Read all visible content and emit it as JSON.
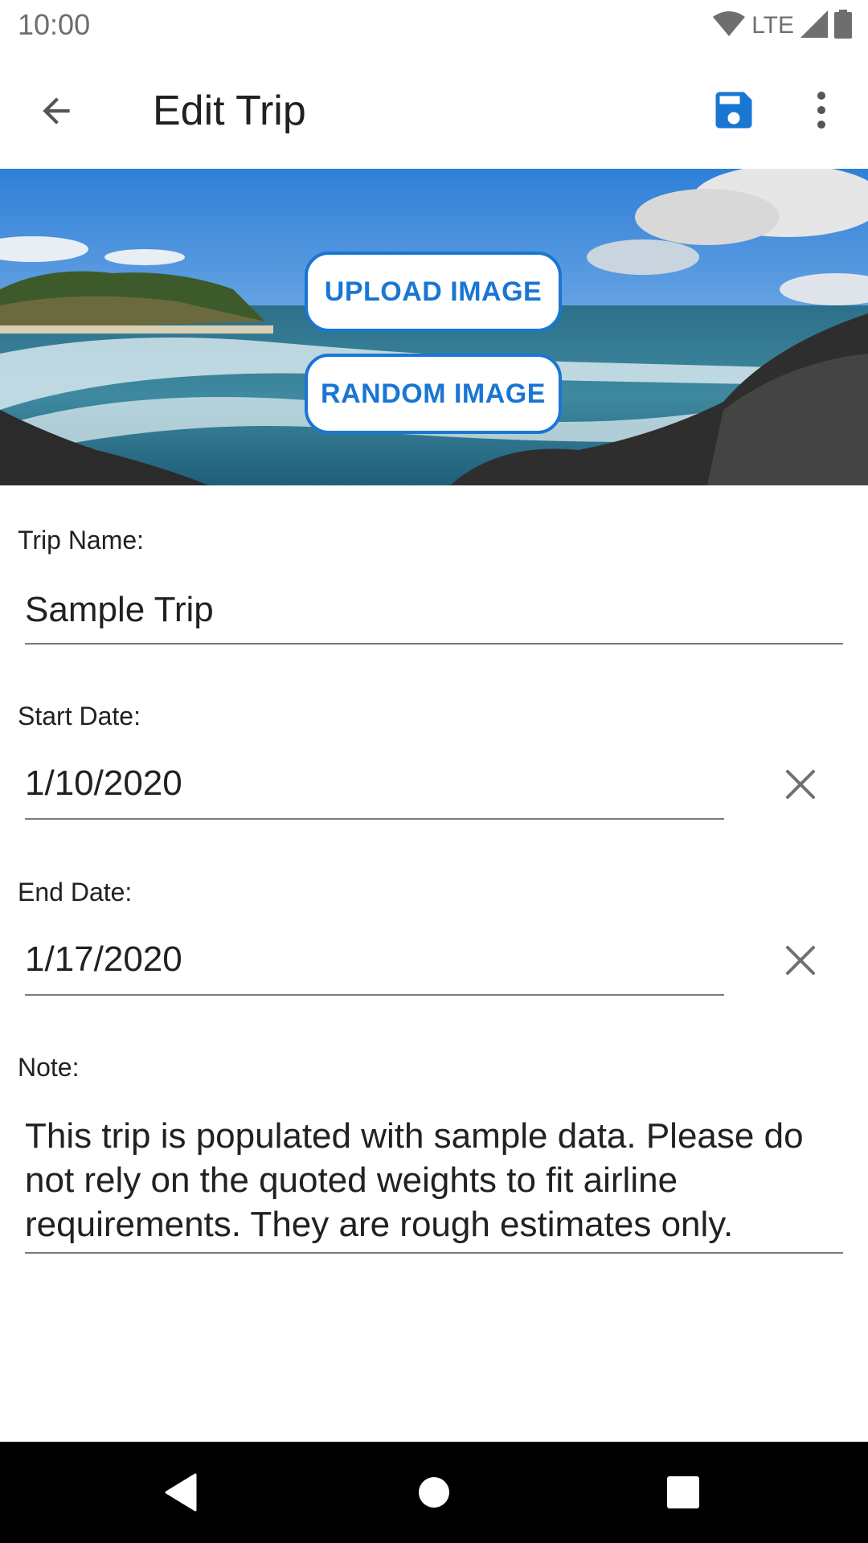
{
  "status_bar": {
    "time": "10:00",
    "network_label": "LTE",
    "icons": [
      "wifi-icon",
      "cell-signal-icon",
      "battery-icon"
    ]
  },
  "app_bar": {
    "title": "Edit Trip",
    "back_icon": "arrow-back-icon",
    "save_icon": "save-icon",
    "overflow_icon": "more-vert-icon"
  },
  "hero": {
    "upload_label": "UPLOAD IMAGE",
    "random_label": "RANDOM IMAGE"
  },
  "form": {
    "trip_name_label": "Trip Name:",
    "trip_name_value": "Sample Trip",
    "start_date_label": "Start Date:",
    "start_date_value": "1/10/2020",
    "end_date_label": "End Date:",
    "end_date_value": "1/17/2020",
    "note_label": "Note:",
    "note_value": "This trip is populated with sample data. Please do not rely on the quoted weights to fit airline requirements. They are rough estimates only."
  },
  "nav_bar": {
    "icons": [
      "nav-back-icon",
      "nav-home-icon",
      "nav-recents-icon"
    ]
  },
  "colors": {
    "accent": "#1976d2",
    "text": "#212121",
    "status_text": "#6e6e6e",
    "nav_bar": "#000000"
  }
}
